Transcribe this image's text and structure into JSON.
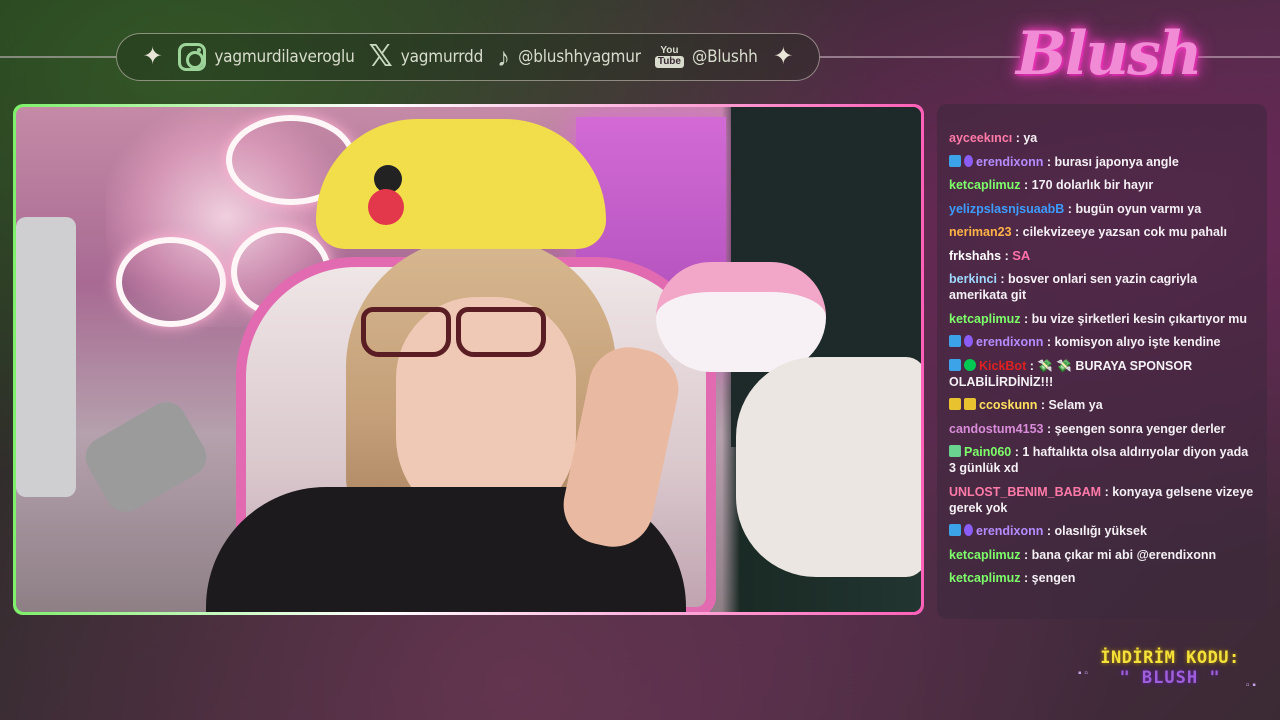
{
  "social": {
    "instagram": "yagmurdilaveroglu",
    "x": "yagmurrdd",
    "tiktok": "@blushhyagmur",
    "youtube": "@Blushh",
    "youtube_icon_top": "You",
    "youtube_icon_bottom": "Tube"
  },
  "logo_text": "Blush",
  "chat": [
    {
      "user": "ayceekıncı",
      "color": "#ff7aa8",
      "badges": [],
      "msg": "ya"
    },
    {
      "user": "erendixonn",
      "color": "#b58cff",
      "badges": [
        "blue",
        "purple"
      ],
      "msg": "burası japonya angle"
    },
    {
      "user": "ketcaplimuz",
      "color": "#7dff6a",
      "badges": [],
      "msg": "170 dolarlık bir hayır"
    },
    {
      "user": "yelizpslasnjsuaabB",
      "color": "#3c9cff",
      "badges": [],
      "msg": "bugün oyun varmı ya"
    },
    {
      "user": "neriman23",
      "color": "#ffb347",
      "badges": [],
      "msg": "cilekvizeeye yazsan cok mu pahalı"
    },
    {
      "user": "frkshahs",
      "color": "#ffffff",
      "badges": [],
      "msg": "SA",
      "emote": true
    },
    {
      "user": "berkinci",
      "color": "#9fd9ff",
      "badges": [],
      "msg": "bosver onlari sen yazin cagriyla amerikata git"
    },
    {
      "user": "ketcaplimuz",
      "color": "#7dff6a",
      "badges": [],
      "msg": "bu vize şirketleri kesin çıkartıyor mu"
    },
    {
      "user": "erendixonn",
      "color": "#b58cff",
      "badges": [
        "blue",
        "purple"
      ],
      "msg": "komisyon alıyo işte kendine"
    },
    {
      "user": "KickBot",
      "color": "#e02020",
      "badges": [
        "blue",
        "green"
      ],
      "msg": "💸 💸 BURAYA SPONSOR OLABİLİRDİNİZ!!!"
    },
    {
      "user": "ccoskunn",
      "color": "#ffe05c",
      "badges": [
        "gold",
        "gold"
      ],
      "msg": "Selam ya"
    },
    {
      "user": "candostum4153",
      "color": "#d98cd9",
      "badges": [],
      "msg": "şeengen sonra yenger derler"
    },
    {
      "user": "Pain060",
      "color": "#7dff6a",
      "badges": [
        "bot"
      ],
      "msg": "1 haftalıkta olsa aldırıyolar diyon yada 3 günlük xd"
    },
    {
      "user": "UNLOST_BENIM_BABAM",
      "color": "#ff7aa8",
      "badges": [],
      "msg": "konyaya gelsene vizeye gerek yok"
    },
    {
      "user": "erendixonn",
      "color": "#b58cff",
      "badges": [
        "blue",
        "purple"
      ],
      "msg": "olasılığı yüksek"
    },
    {
      "user": "ketcaplimuz",
      "color": "#7dff6a",
      "badges": [],
      "msg": "bana çıkar mi abi @erendixonn"
    },
    {
      "user": "ketcaplimuz",
      "color": "#7dff6a",
      "badges": [],
      "msg": "şengen"
    }
  ],
  "discount": {
    "title": "İNDİRİM KODU:",
    "code": "\" BLUSH \""
  },
  "colors": {
    "frame_green": "#7ef06a",
    "frame_pink": "#ff5fb8",
    "logo_pink": "#f28bd6",
    "discount_yellow": "#f4e23a",
    "discount_purple": "#9f5fdc"
  }
}
